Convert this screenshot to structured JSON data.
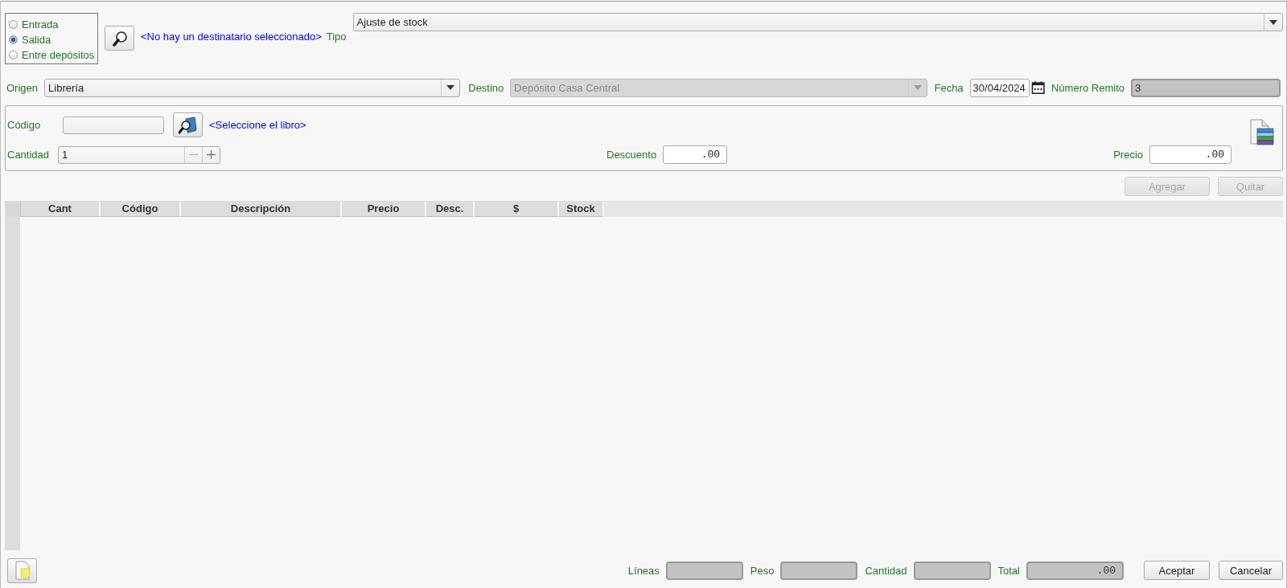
{
  "movement_type": [
    {
      "label": "Entrada",
      "selected": false
    },
    {
      "label": "Salida",
      "selected": true
    },
    {
      "label": "Entre depósitos",
      "selected": false
    }
  ],
  "recipient_link": "<No hay un destinatario seleccionado>",
  "tipo": {
    "label": "Tipo",
    "value": "Ajuste de stock"
  },
  "origen": {
    "label": "Origen",
    "value": "Librería",
    "disabled": false
  },
  "destino": {
    "label": "Destino",
    "value": "Depósito Casa Central",
    "disabled": true
  },
  "fecha": {
    "label": "Fecha",
    "value": "30/04/2024"
  },
  "numero_remito": {
    "label": "Número Remito",
    "value": "3"
  },
  "item": {
    "codigo_label": "Código",
    "book_link": "<Seleccione el libro>",
    "cantidad_label": "Cantidad",
    "cantidad": "1",
    "descuento_label": "Descuento",
    "descuento": ".00",
    "precio_label": "Precio",
    "precio": ".00"
  },
  "actions": [
    {
      "label": "Agregar",
      "disabled": true
    },
    {
      "label": "Quitar",
      "disabled": true
    }
  ],
  "table": {
    "columns": [
      "Cant",
      "Código",
      "Descripción",
      "Precio",
      "Desc.",
      "$",
      "Stock"
    ]
  },
  "totals": [
    {
      "label": "Líneas"
    },
    {
      "label": "Peso"
    },
    {
      "label": "Cantidad"
    },
    {
      "label": "Total",
      "value": ".00"
    }
  ],
  "buttons": [
    "Aceptar",
    "Cancelar"
  ]
}
